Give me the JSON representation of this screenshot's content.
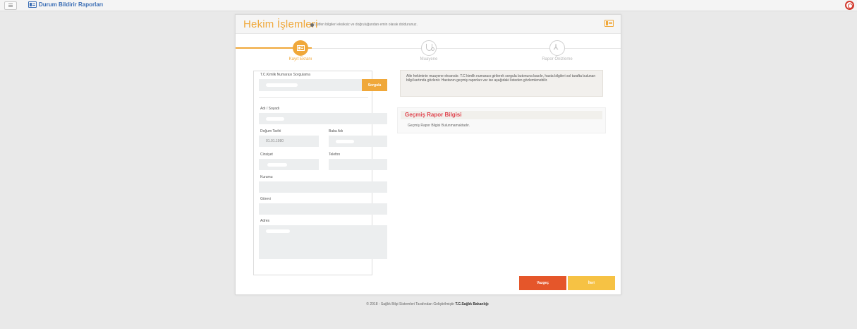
{
  "app": {
    "title": "Durum Bildirir Raporları"
  },
  "header": {
    "title": "Hekim İşlemleri",
    "subtitle": "Lütfen bilgileri eksiksiz ve doğruluğundan emin olarak doldurunuz."
  },
  "steps": [
    {
      "label": "Kayıt Ekranı",
      "state": "active",
      "icon": "id-card-icon"
    },
    {
      "label": "Muayene",
      "state": "idle",
      "icon": "stethoscope-icon"
    },
    {
      "label": "Rapor Önizleme",
      "state": "idle",
      "icon": "pdf-icon"
    }
  ],
  "form": {
    "tc_label": "T.C.Kimlik Numarası Sorgulama",
    "query_button": "Sorgula",
    "name_label": "Adı / Soyadı",
    "birth_label": "Doğum Tarihi",
    "birth_value": "01.01.1980",
    "father_label": "Baba Adı",
    "gender_label": "Cinsiyet",
    "phone_label": "Telefon",
    "institution_label": "Kurumu",
    "duty_label": "Görevi",
    "address_label": "Adres"
  },
  "notice": "Aile hekiminin muayene ekranıdır. T.C kimlik numarası girilerek sorgula butonuna basılır, hasta bilgileri sol tarafta bulunan bilgi kartında gözlenir. Hastanın geçmiş raporları var ise aşağıdaki listeden gözlemlenebilir.",
  "history": {
    "title": "Geçmiş Rapor Bilgisi",
    "empty_text": "Geçmiş Rapor Bilgisi Bulunmamaktadır."
  },
  "buttons": {
    "cancel": "Vazgeç",
    "next": "İleri"
  },
  "footer": {
    "text": "© 2018 - Sağlık Bilgi Sistemleri Tarafından Geliştirilmiştir",
    "org": "T.C.Sağlık Bakanlığı"
  },
  "colors": {
    "accent": "#f0a83a",
    "danger": "#e5562a",
    "warning": "#f6c244",
    "title_blue": "#3b6eb5",
    "history_red": "#e0454f"
  }
}
